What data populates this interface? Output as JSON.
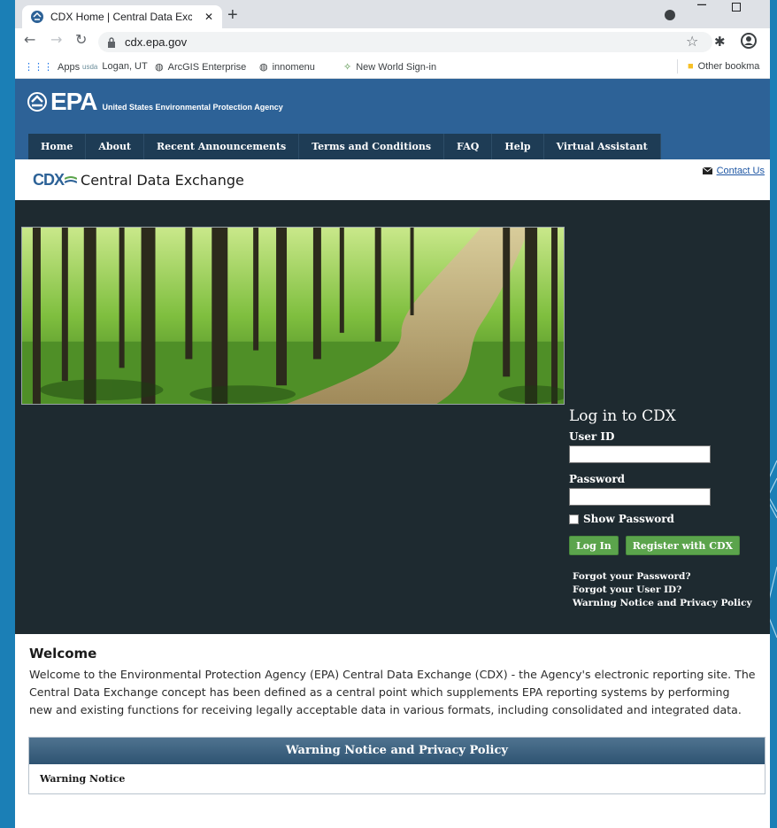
{
  "browser": {
    "tab_title": "CDX Home | Central Data Exchan",
    "tab_close": "✕",
    "new_tab": "+",
    "url": "cdx.epa.gov",
    "bookmarks": [
      {
        "label": "Apps",
        "icon": "apps-grid-icon"
      },
      {
        "label": "Logan, UT",
        "icon": "usda-icon"
      },
      {
        "label": "ArcGIS Enterprise",
        "icon": "globe-icon"
      },
      {
        "label": "innomenu",
        "icon": "globe-icon"
      },
      {
        "label": "New World Sign-in",
        "icon": "sparkle-icon"
      }
    ],
    "other_bookmarks": "Other bookma"
  },
  "header": {
    "logo_word": "EPA",
    "agency": "United States Environmental Protection Agency",
    "nav": [
      "Home",
      "About",
      "Recent Announcements",
      "Terms and Conditions",
      "FAQ",
      "Help",
      "Virtual Assistant"
    ]
  },
  "cdx": {
    "abbr": "CDX",
    "name": "Central Data Exchange",
    "contact": "Contact Us"
  },
  "login": {
    "title": "Log in to CDX",
    "user_id_label": "User ID",
    "password_label": "Password",
    "show_password": "Show Password",
    "login_button": "Log In",
    "register_button": "Register with CDX",
    "links": [
      "Forgot your Password?",
      "Forgot your User ID?",
      "Warning Notice and Privacy Policy"
    ]
  },
  "welcome": {
    "heading": "Welcome",
    "body": "Welcome to the Environmental Protection Agency (EPA) Central Data Exchange (CDX) - the Agency's electronic reporting site. The Central Data Exchange concept has been defined as a central point which supplements EPA reporting systems by performing new and existing functions for receiving legally acceptable data in various formats, including consolidated and integrated data."
  },
  "warning": {
    "heading": "Warning Notice and Privacy Policy",
    "subheading": "Warning Notice"
  },
  "colors": {
    "epa_blue": "#2d6297",
    "nav_dark": "#1e3c55",
    "hero_dark": "#1e2a30",
    "button_green": "#5ba44c",
    "slide_bg": "#1b7fb6"
  }
}
